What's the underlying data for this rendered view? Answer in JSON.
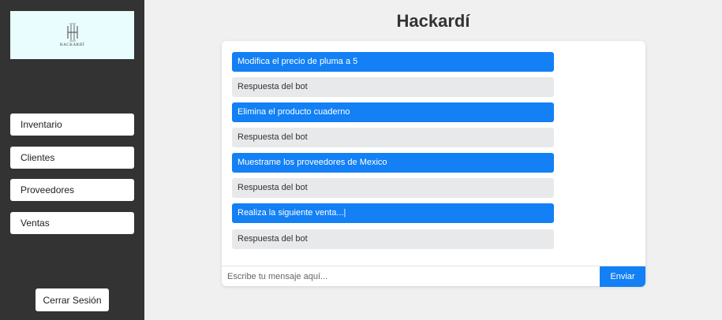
{
  "sidebar": {
    "logo": {
      "text": "HACKARDÍ",
      "sub": "",
      "background": "#e9fdfe",
      "icon": "h-monogram-icon"
    },
    "items": [
      {
        "label": "Inventario"
      },
      {
        "label": "Clientes"
      },
      {
        "label": "Proveedores"
      },
      {
        "label": "Ventas"
      }
    ],
    "logout_label": "Cerrar Sesión"
  },
  "header": {
    "title": "Hackardí"
  },
  "chat": {
    "messages": [
      {
        "role": "user",
        "text": "Modifica el precio de pluma a 5"
      },
      {
        "role": "bot",
        "text": "Respuesta del bot"
      },
      {
        "role": "user",
        "text": "Elimina el producto cuaderno"
      },
      {
        "role": "bot",
        "text": "Respuesta del bot"
      },
      {
        "role": "user",
        "text": "Muestrame los proveedores de Mexico"
      },
      {
        "role": "bot",
        "text": "Respuesta del bot"
      },
      {
        "role": "user",
        "text": "Realiza la siguiente venta...|"
      },
      {
        "role": "bot",
        "text": "Respuesta del bot"
      }
    ],
    "input_value": "",
    "input_placeholder": "Escribe tu mensaje aquí...",
    "send_label": "Enviar"
  },
  "colors": {
    "sidebar": "#333333",
    "accent": "#1380f5",
    "bot_bubble": "#e8e9eb",
    "page_bg": "#f0f0f0"
  }
}
